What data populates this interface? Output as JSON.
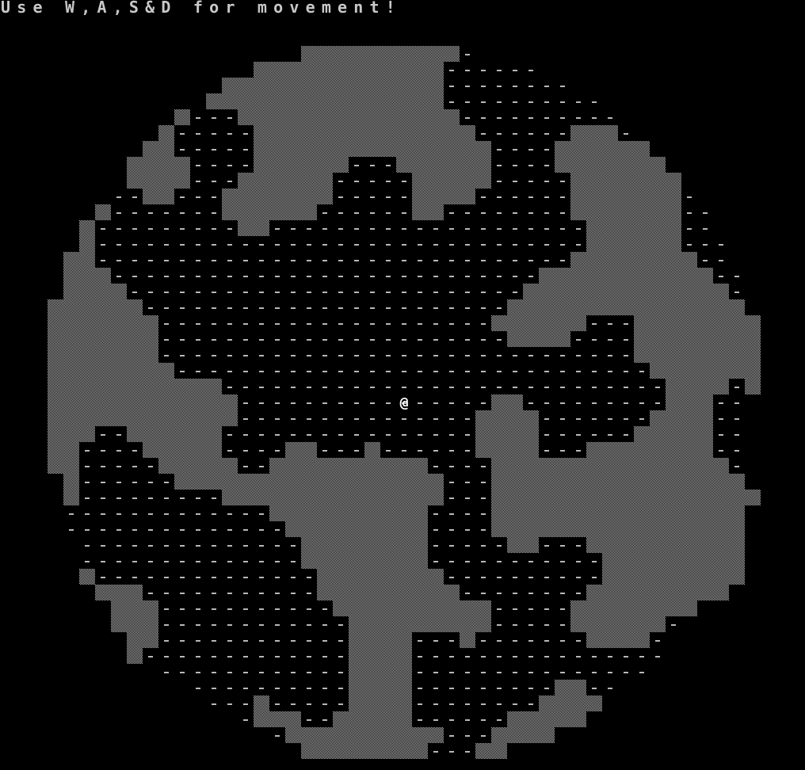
{
  "hud": {
    "instructions": "Use W,A,S&D for movement!"
  },
  "map": {
    "description": "roguelike cave map",
    "player_glyph": "@",
    "floor_glyph": "-",
    "colors": {
      "background": "#000000",
      "wall": "#b4b4b4",
      "floor": "#b8b8b8",
      "player": "#ffffff",
      "text": "#c8c8c8"
    }
  }
}
